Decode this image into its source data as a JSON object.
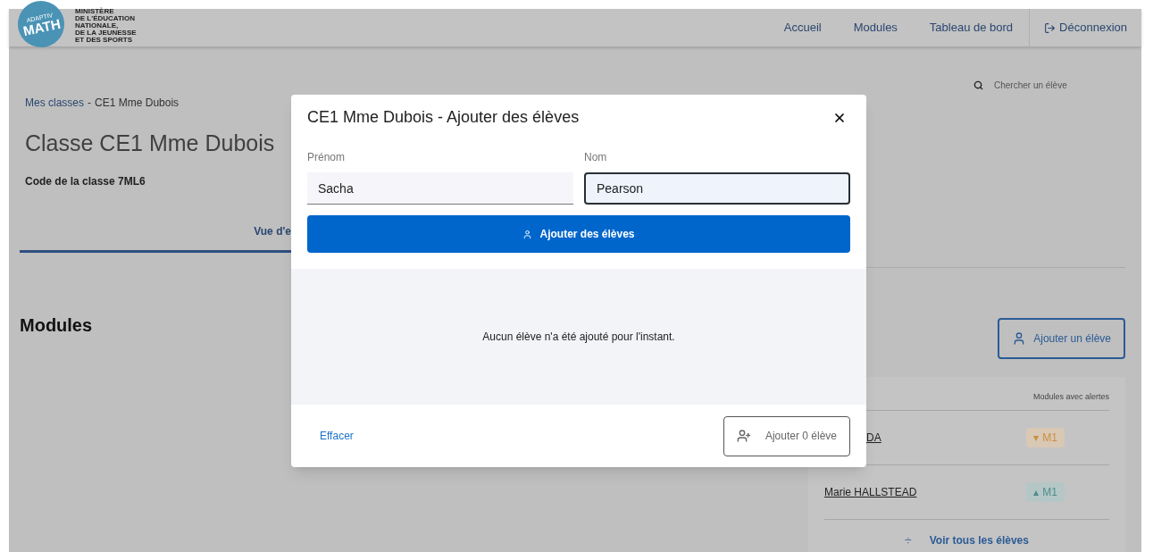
{
  "header": {
    "logo": {
      "badge_top": "ADAPTIV",
      "badge_main": "MATH",
      "ministry_lines": [
        "MINISTÈRE",
        "DE L'ÉDUCATION",
        "NATIONALE,",
        "DE LA JEUNESSE",
        "ET DES SPORTS"
      ]
    },
    "nav": [
      {
        "label": "Accueil",
        "kind": "link"
      },
      {
        "label": "Modules",
        "kind": "link"
      },
      {
        "label": "Tableau de bord",
        "kind": "link"
      },
      {
        "label": "Déconnexion",
        "kind": "logout"
      }
    ]
  },
  "search": {
    "placeholder": "Chercher un élève"
  },
  "breadcrumb": {
    "items": [
      "Mes classes",
      "CE1 Mme Dubois"
    ],
    "separator": "-"
  },
  "class_title": "Classe CE1 Mme Dubois",
  "class_code": "Code de la classe 7ML6",
  "tabs": [
    {
      "label": "Vue d'e",
      "selected": true
    }
  ],
  "modules_heading": "Modules",
  "add_student_button": "Ajouter un élève",
  "students_card": {
    "column_header": "Modules avec alertes",
    "rows": [
      {
        "name": "DA",
        "alert": "M1",
        "arrow": "▾",
        "kind": "down"
      },
      {
        "name": "Marie HALLSTEAD",
        "alert": "M1",
        "arrow": "▴",
        "kind": "up"
      }
    ],
    "see_all_icon": "÷",
    "see_all": "Voir tous les élèves"
  },
  "modal": {
    "title": "CE1 Mme Dubois - Ajouter des élèves",
    "fields": [
      {
        "label": "Prénom",
        "value": "Sacha",
        "focused": false
      },
      {
        "label": "Nom",
        "value": "Pearson",
        "focused": true
      }
    ],
    "add_button": "Ajouter des élèves",
    "empty_message": "Aucun élève n'a été ajouté pour l'instant.",
    "clear_button": "Effacer",
    "submit_button": "Ajouter 0 élève"
  }
}
